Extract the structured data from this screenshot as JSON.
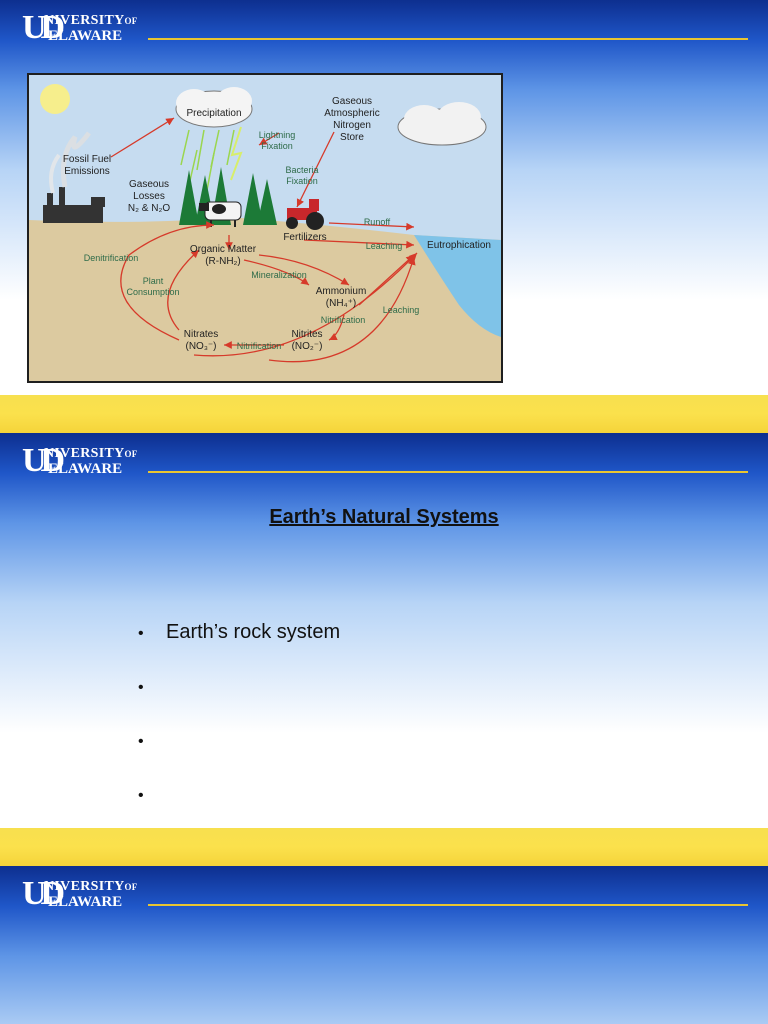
{
  "logo": {
    "line1": "NIVERSITY",
    "of": "OF",
    "line2": "ELAWARE",
    "mark": "UD"
  },
  "diagram": {
    "labels": {
      "precipitation": "Precipitation",
      "gas1": "Gaseous",
      "gas2": "Atmospheric",
      "gas3": "Nitrogen",
      "gas4": "Store",
      "lightning1": "Lightning",
      "lightning2": "Fixation",
      "fossil1": "Fossil Fuel",
      "fossil2": "Emissions",
      "losses1": "Gaseous",
      "losses2": "Losses",
      "losses3": "N₂ & N₂O",
      "bacteria1": "Bacteria",
      "bacteria2": "Fixation",
      "runoff": "Runoff",
      "fertilizers": "Fertilizers",
      "leaching1": "Leaching",
      "eutrophication": "Eutrophication",
      "denitrification": "Denitrification",
      "organic1": "Organic Matter",
      "organic2": "(R-NH₂)",
      "mineralization": "Mineralization",
      "plant1": "Plant",
      "plant2": "Consumption",
      "ammonium1": "Ammonium",
      "ammonium2": "(NH₄⁺)",
      "nitrification1": "Nitrification",
      "leaching2": "Leaching",
      "nitrates1": "Nitrates",
      "nitrates2": "(NO₃⁻)",
      "nitrites1": "Nitrites",
      "nitrites2": "(NO₂⁻)",
      "nitrification2": "Nitrification"
    }
  },
  "slide2": {
    "title": "Earth’s Natural Systems",
    "bullets": [
      {
        "marker": "•",
        "text": "Earth’s rock system"
      },
      {
        "marker": "•",
        "text": ""
      },
      {
        "marker": "•",
        "text": ""
      },
      {
        "marker": "•",
        "text": ""
      }
    ]
  }
}
